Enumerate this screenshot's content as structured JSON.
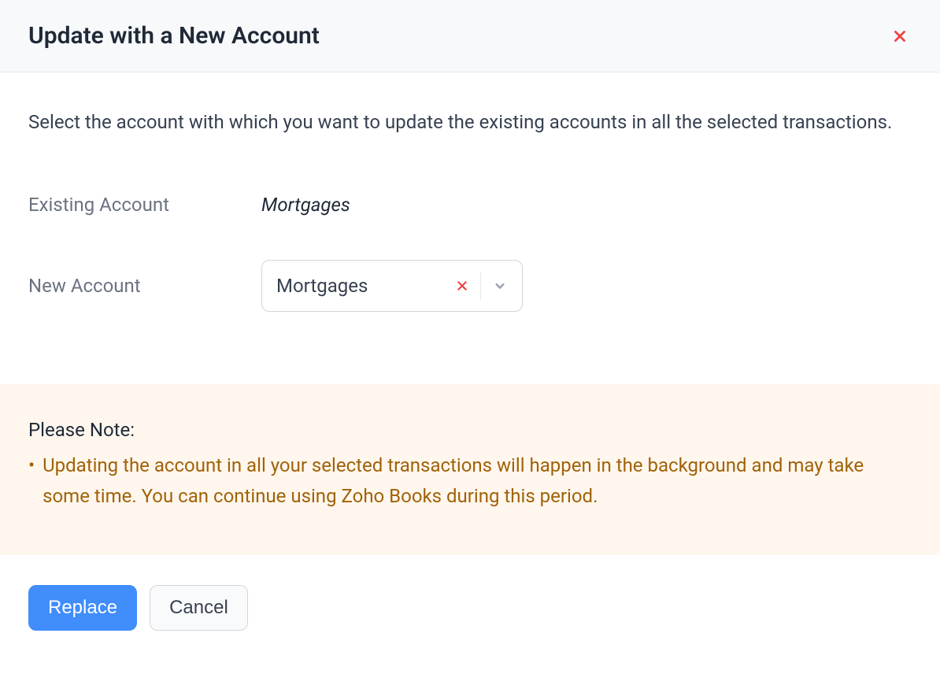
{
  "header": {
    "title": "Update with a New Account"
  },
  "body": {
    "description": "Select the account with which you want to update the existing accounts in all the selected transactions.",
    "existing_account_label": "Existing Account",
    "existing_account_value": "Mortgages",
    "new_account_label": "New Account",
    "new_account_value": "Mortgages"
  },
  "note": {
    "title": "Please Note:",
    "items": [
      "Updating the account in all your selected transactions will happen in the background and may take some time. You can continue using Zoho Books during this period."
    ]
  },
  "footer": {
    "replace_label": "Replace",
    "cancel_label": "Cancel"
  }
}
